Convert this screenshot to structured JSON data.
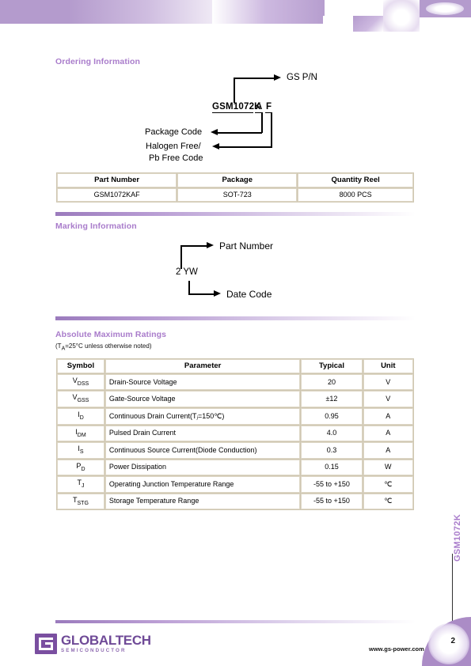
{
  "meta": {
    "accent_purple": "#a97ccb",
    "logo_purple": "#6f4a97",
    "table_border": "#ded7c6"
  },
  "ordering": {
    "title": "Ordering Information",
    "part_number_main": "GSM1072K",
    "part_number_pkg": "A",
    "part_number_halogen": "F",
    "callout_gs_pn": "GS P/N",
    "callout_package": "Package Code",
    "callout_halogen_line1": "Halogen Free/",
    "callout_halogen_line2": "Pb Free Code",
    "table": {
      "headers": [
        "Part Number",
        "Package",
        "Quantity Reel"
      ],
      "rows": [
        [
          "GSM1072KAF",
          "SOT-723",
          "8000 PCS"
        ]
      ]
    }
  },
  "marking": {
    "title": "Marking Information",
    "code": "2 YW",
    "callout_part_number": "Part Number",
    "callout_date_code": "Date Code"
  },
  "ratings": {
    "title": "Absolute Maximum Ratings",
    "condition_pre": "(T",
    "condition_sub": "A",
    "condition_post": "=25°C unless otherwise noted)",
    "headers": [
      "Symbol",
      "Parameter",
      "Typical",
      "Unit"
    ],
    "rows": [
      {
        "sym_main": "V",
        "sym_sub": "DSS",
        "parameter": "Drain-Source Voltage",
        "typical": "20",
        "unit": "V"
      },
      {
        "sym_main": "V",
        "sym_sub": "GSS",
        "parameter": "Gate-Source Voltage",
        "typical": "±12",
        "unit": "V"
      },
      {
        "sym_main": "I",
        "sym_sub": "D",
        "parameter": "Continuous Drain Current(Tⱼ=150℃)",
        "typical": "0.95",
        "unit": "A"
      },
      {
        "sym_main": "I",
        "sym_sub": "DM",
        "parameter": "Pulsed Drain Current",
        "typical": "4.0",
        "unit": "A"
      },
      {
        "sym_main": "I",
        "sym_sub": "S",
        "parameter": "Continuous Source Current(Diode Conduction)",
        "typical": "0.3",
        "unit": "A"
      },
      {
        "sym_main": "P",
        "sym_sub": "D",
        "parameter": "Power Dissipation",
        "typical": "0.15",
        "unit": "W"
      },
      {
        "sym_main": "T",
        "sym_sub": "J",
        "parameter": "Operating Junction Temperature Range",
        "typical": "-55 to +150",
        "unit": "℃"
      },
      {
        "sym_main": "T",
        "sym_sub": "STG",
        "parameter": "Storage Temperature Range",
        "typical": "-55 to +150",
        "unit": "℃"
      }
    ]
  },
  "side_tab": {
    "label": "GSM1072K"
  },
  "footer": {
    "logo_main": "GLOBALTECH",
    "logo_sub": "SEMICONDUCTOR",
    "website": "www.gs-power.com",
    "page_number": "2"
  }
}
